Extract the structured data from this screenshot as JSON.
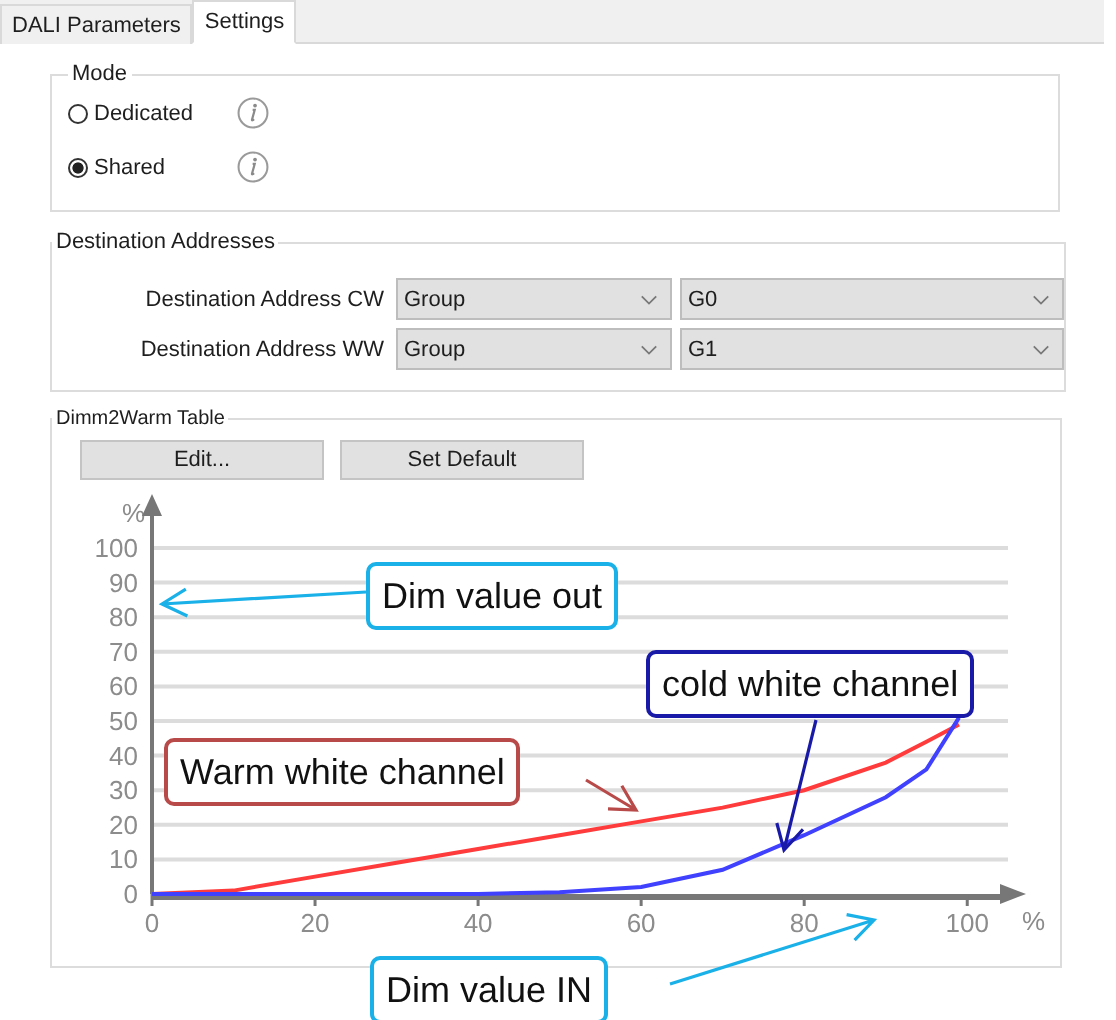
{
  "tabs": [
    {
      "label": "DALI Parameters",
      "selected": false
    },
    {
      "label": "Settings",
      "selected": true
    }
  ],
  "mode": {
    "title": "Mode",
    "options": [
      {
        "label": "Dedicated",
        "selected": false
      },
      {
        "label": "Shared",
        "selected": true
      }
    ]
  },
  "destination_addresses": {
    "title": "Destination Addresses",
    "rows": [
      {
        "label": "Destination Address CW",
        "type": "Group",
        "address": "G0"
      },
      {
        "label": "Destination Address WW",
        "type": "Group",
        "address": "G1"
      }
    ]
  },
  "dimm2warm_table": {
    "title": "Dimm2Warm Table",
    "buttons": [
      "Edit...",
      "Set Default"
    ],
    "chart_data": {
      "type": "line",
      "xlabel": "%",
      "ylabel": "%",
      "x": [
        0,
        10,
        20,
        30,
        40,
        50,
        60,
        70,
        80,
        90,
        95,
        99
      ],
      "series": [
        {
          "name": "Warm white channel",
          "color": "#ff3b3b",
          "values": [
            0,
            1,
            5,
            9,
            13,
            17,
            21,
            25,
            30,
            38,
            44,
            49
          ]
        },
        {
          "name": "cold white channel",
          "color": "#4040ff",
          "values": [
            0,
            0,
            0,
            0,
            0,
            0.5,
            2,
            7,
            17,
            28,
            36,
            51
          ]
        }
      ],
      "xlim": [
        0,
        105
      ],
      "ylim": [
        0,
        100
      ],
      "xticks": [
        0,
        20,
        40,
        60,
        80,
        100
      ],
      "yticks": [
        0,
        10,
        20,
        30,
        40,
        50,
        60,
        70,
        80,
        90,
        100
      ],
      "grid": true
    },
    "callouts": [
      {
        "text": "Dim value out",
        "color": "#1ab0e8"
      },
      {
        "text": "Dim value IN",
        "color": "#1ab0e8"
      }
    ]
  }
}
